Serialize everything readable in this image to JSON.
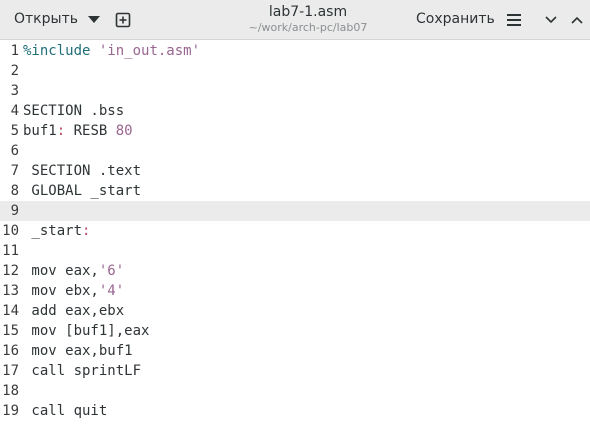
{
  "header": {
    "open_label": "Открыть",
    "title": "lab7-1.asm",
    "subtitle": "~/work/arch-pc/lab07",
    "save_label": "Сохранить"
  },
  "icons": {
    "open_dropdown": "chevron-down-icon",
    "new_tab": "new-tab-icon",
    "menu": "hamburger-menu-icon",
    "minimize": "minimize-icon",
    "maximize": "maximize-icon"
  },
  "editor": {
    "current_line": 9,
    "lines": [
      {
        "num": "1",
        "tokens": [
          {
            "t": "%include",
            "c": "preproc"
          },
          {
            "t": " ",
            "c": ""
          },
          {
            "t": "'in_out.asm'",
            "c": "string"
          }
        ]
      },
      {
        "num": "2",
        "tokens": []
      },
      {
        "num": "3",
        "tokens": []
      },
      {
        "num": "4",
        "tokens": [
          {
            "t": "SECTION .bss",
            "c": ""
          }
        ]
      },
      {
        "num": "5",
        "tokens": [
          {
            "t": "buf1",
            "c": ""
          },
          {
            "t": ":",
            "c": "colon"
          },
          {
            "t": " RESB ",
            "c": ""
          },
          {
            "t": "80",
            "c": "number"
          }
        ]
      },
      {
        "num": "6",
        "tokens": []
      },
      {
        "num": "7",
        "tokens": [
          {
            "t": " SECTION .text",
            "c": ""
          }
        ]
      },
      {
        "num": "8",
        "tokens": [
          {
            "t": " GLOBAL _start",
            "c": ""
          }
        ]
      },
      {
        "num": "9",
        "tokens": []
      },
      {
        "num": "10",
        "tokens": [
          {
            "t": " _start",
            "c": ""
          },
          {
            "t": ":",
            "c": "colon"
          }
        ]
      },
      {
        "num": "11",
        "tokens": []
      },
      {
        "num": "12",
        "tokens": [
          {
            "t": " mov eax,",
            "c": ""
          },
          {
            "t": "'6'",
            "c": "string"
          }
        ]
      },
      {
        "num": "13",
        "tokens": [
          {
            "t": " mov ebx,",
            "c": ""
          },
          {
            "t": "'4'",
            "c": "string"
          }
        ]
      },
      {
        "num": "14",
        "tokens": [
          {
            "t": " add eax,ebx",
            "c": ""
          }
        ]
      },
      {
        "num": "15",
        "tokens": [
          {
            "t": " mov [buf1],eax",
            "c": ""
          }
        ]
      },
      {
        "num": "16",
        "tokens": [
          {
            "t": " mov eax,buf1",
            "c": ""
          }
        ]
      },
      {
        "num": "17",
        "tokens": [
          {
            "t": " call sprintLF",
            "c": ""
          }
        ]
      },
      {
        "num": "18",
        "tokens": []
      },
      {
        "num": "19",
        "tokens": [
          {
            "t": " call quit",
            "c": ""
          }
        ]
      }
    ]
  },
  "colors": {
    "headerbar_bg": "#ebebeb",
    "current_line_bg": "#ebebeb",
    "preproc": "#1f6f78",
    "string": "#9a6591"
  }
}
